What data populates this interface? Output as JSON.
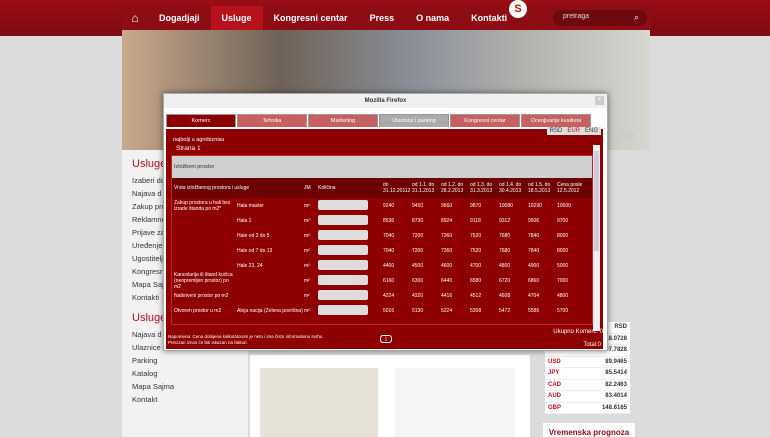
{
  "nav": {
    "items": [
      "Dogadjaji",
      "Usluge",
      "Kongresni centar",
      "Press",
      "O nama",
      "Kontakti"
    ],
    "active": 1,
    "search_placeholder": "pretraga"
  },
  "sidebar": {
    "heading1": "Usluge",
    "items1": [
      "Izaberi do",
      "Najava d",
      "Zakup pro",
      "Reklamne",
      "Prijave za",
      "Uređenje",
      "Ugostitelj",
      "Kongresn",
      "Mapa Saj",
      "Kontakti"
    ],
    "heading2": "Usluge",
    "items2": [
      "Najava d",
      "Ulaznice",
      "Parking",
      "Katalog",
      "Mapa Sajma",
      "Kontakt"
    ]
  },
  "rates": {
    "header": "RSD",
    "rows": [
      [
        "",
        "18.0728"
      ],
      [
        "",
        "07.7828"
      ],
      [
        "USD",
        "89.9465"
      ],
      [
        "JPY",
        "85.5414"
      ],
      [
        "CAD",
        "82.2463"
      ],
      [
        "AUD",
        "83.4014"
      ],
      [
        "GBP",
        "148.6165"
      ]
    ]
  },
  "weather": "Vremenska prognoza",
  "modal": {
    "title": "Mozilla Firefox",
    "tabs": [
      "Komerc",
      "Tehnika",
      "Marketing",
      "Ulaznice i parking",
      "Kongresni centar",
      "Ocenjivanje kvaliteta"
    ],
    "currencies": [
      "RSD",
      "EUR",
      "ENG"
    ],
    "subtitle": "najbolji u agrobiznisu",
    "page": "Strana 1",
    "section": "Izložbeni prostor",
    "headers": [
      "Vrsta izložbenog prostora i usluge",
      "JM",
      "Količina",
      "do 31.12.20112",
      "od 1.1. do 31.1.2013",
      "od 1.2. do 28.2.2013",
      "od 1.3. do 31.3.2013",
      "od 1.4. do 30.4.2013",
      "od 1.5. do 18.5.2013",
      "Cena posle 12.5.2012"
    ],
    "rows": [
      {
        "group": "Zakup prostora u hali bez izrade štanda po m2*",
        "item": "Hala master",
        "unit": "m²",
        "prices": [
          "9240",
          "9450",
          "9660",
          "9870",
          "10080",
          "10290",
          "10500"
        ]
      },
      {
        "group": "",
        "item": "Hala 1",
        "unit": "m²",
        "prices": [
          "8536",
          "8730",
          "8924",
          "9118",
          "9312",
          "9506",
          "9700"
        ]
      },
      {
        "group": "",
        "item": "Hale od 3 do 5",
        "unit": "m²",
        "prices": [
          "7040",
          "7200",
          "7360",
          "7520",
          "7680",
          "7840",
          "8000"
        ]
      },
      {
        "group": "",
        "item": "Hale od 7 do 13",
        "unit": "m²",
        "prices": [
          "7040",
          "7200",
          "7360",
          "7520",
          "7680",
          "7840",
          "8000"
        ]
      },
      {
        "group": "",
        "item": "Hale 23, 24",
        "unit": "m²",
        "prices": [
          "4400",
          "4500",
          "4600",
          "4700",
          "4800",
          "4900",
          "5000"
        ]
      },
      {
        "group": "Kancelarija ili štand kućica (neopremljen prostor) po m2",
        "item": "",
        "unit": "m²",
        "prices": [
          "6160",
          "6300",
          "6440",
          "6580",
          "6720",
          "6860",
          "7000"
        ]
      },
      {
        "group": "Natkriveni prostor po m2",
        "item": "",
        "unit": "m²",
        "prices": [
          "4224",
          "4320",
          "4416",
          "4512",
          "4608",
          "4704",
          "4800"
        ]
      },
      {
        "group": "Otvoren prostor u m2",
        "item": "Aleja nacija (Zelena površina)",
        "unit": "m²",
        "prices": [
          "5016",
          "5130",
          "5224",
          "5358",
          "5472",
          "5586",
          "5700"
        ]
      }
    ],
    "note1": "Napomena: Cena dobijena kalkulatorom je neto i ima čisto informativnu svrhu.",
    "note2": "Precizan iznos će biti iskazan na fakturi.",
    "total_komerc": "Ukupno Komerc: 0",
    "total": "Total:0"
  }
}
